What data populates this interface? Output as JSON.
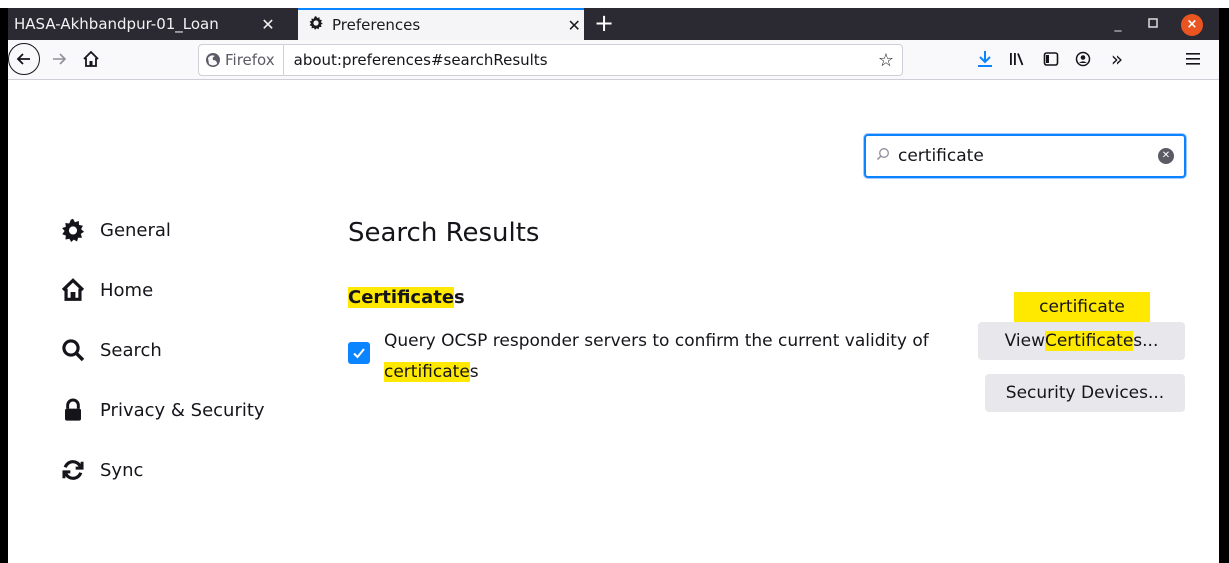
{
  "tabs": [
    {
      "title": "HASA-Akhbandpur-01_Loan",
      "active": false
    },
    {
      "title": "Preferences",
      "active": true
    }
  ],
  "window": {
    "minimize": "_",
    "maximize": "▫",
    "close": "×"
  },
  "urlbar": {
    "identity": "Firefox",
    "url": "about:preferences#searchResults"
  },
  "search": {
    "value": "certificate"
  },
  "sidebar": {
    "items": [
      {
        "label": "General",
        "icon": "gear-icon"
      },
      {
        "label": "Home",
        "icon": "home-icon"
      },
      {
        "label": "Search",
        "icon": "search-icon"
      },
      {
        "label": "Privacy & Security",
        "icon": "lock-icon"
      },
      {
        "label": "Sync",
        "icon": "sync-icon"
      }
    ]
  },
  "main": {
    "title": "Search Results",
    "section_heading_hl": "Certificate",
    "section_heading_rest": "s",
    "checkbox": {
      "checked": true,
      "label_part1": "Query OCSP responder servers to confirm the current validity of ",
      "label_hl": "certificate",
      "label_part2": "s"
    },
    "tooltip": "certificate",
    "view_certificates": {
      "pre": "View ",
      "hl": "Certificate",
      "post": "s..."
    },
    "security_devices": "Security Devices..."
  },
  "colors": {
    "accent": "#0a84ff",
    "highlight": "#ffe900",
    "tabbar": "#2b2a33"
  }
}
